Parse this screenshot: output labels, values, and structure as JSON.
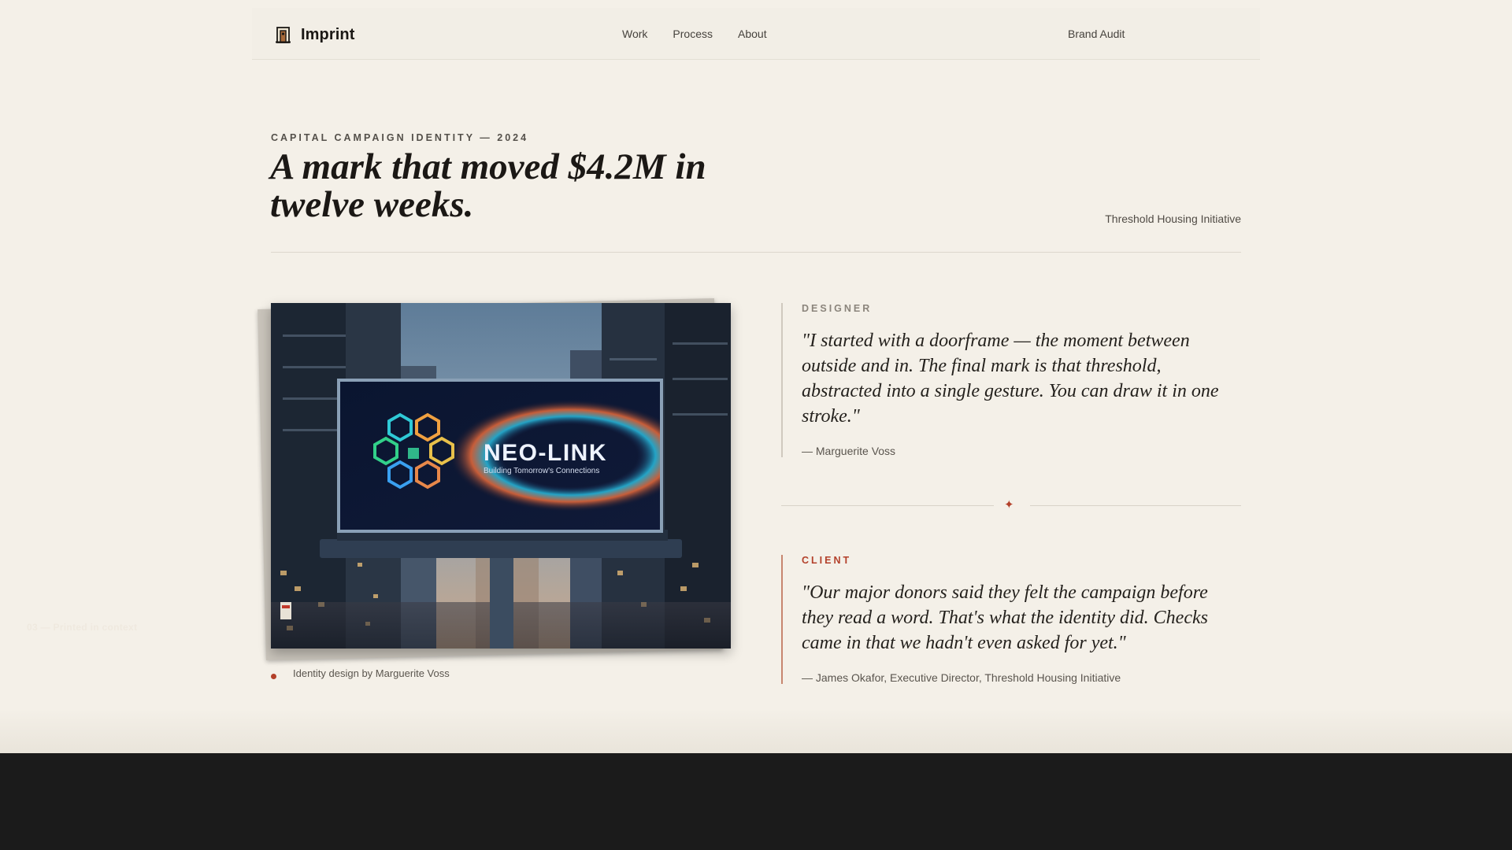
{
  "header": {
    "brand_name": "Imprint",
    "nav": [
      "Work",
      "Process",
      "About"
    ],
    "cta": "Brand Audit"
  },
  "hero": {
    "eyebrow": "CAPITAL CAMPAIGN IDENTITY — 2024",
    "title": "A mark that moved $4.2M in twelve weeks.",
    "client": "Threshold Housing Initiative"
  },
  "image": {
    "billboard_title": "NEO-LINK",
    "billboard_tagline": "Building Tomorrow's Connections",
    "caption": "03 — Printed in context",
    "credit": "Identity design by Marguerite Voss"
  },
  "quotes": {
    "designer": {
      "label": "DESIGNER",
      "text": "\"I started with a doorframe — the moment between outside and in. The final mark is that threshold, abstracted into a single gesture. You can draw it in one stroke.\"",
      "attribution": "— Marguerite Voss"
    },
    "divider_glyph": "✦",
    "client": {
      "label": "CLIENT",
      "text": "\"Our major donors said they felt the campaign before they read a word. That's what the identity did. Checks came in that we hadn't even asked for yet.\"",
      "attribution": "— James Okafor, Executive Director, Threshold Housing Initiative"
    }
  },
  "colors": {
    "background": "#f4f0e8",
    "accent": "#b3402a",
    "footer": "#1b1b1b"
  }
}
